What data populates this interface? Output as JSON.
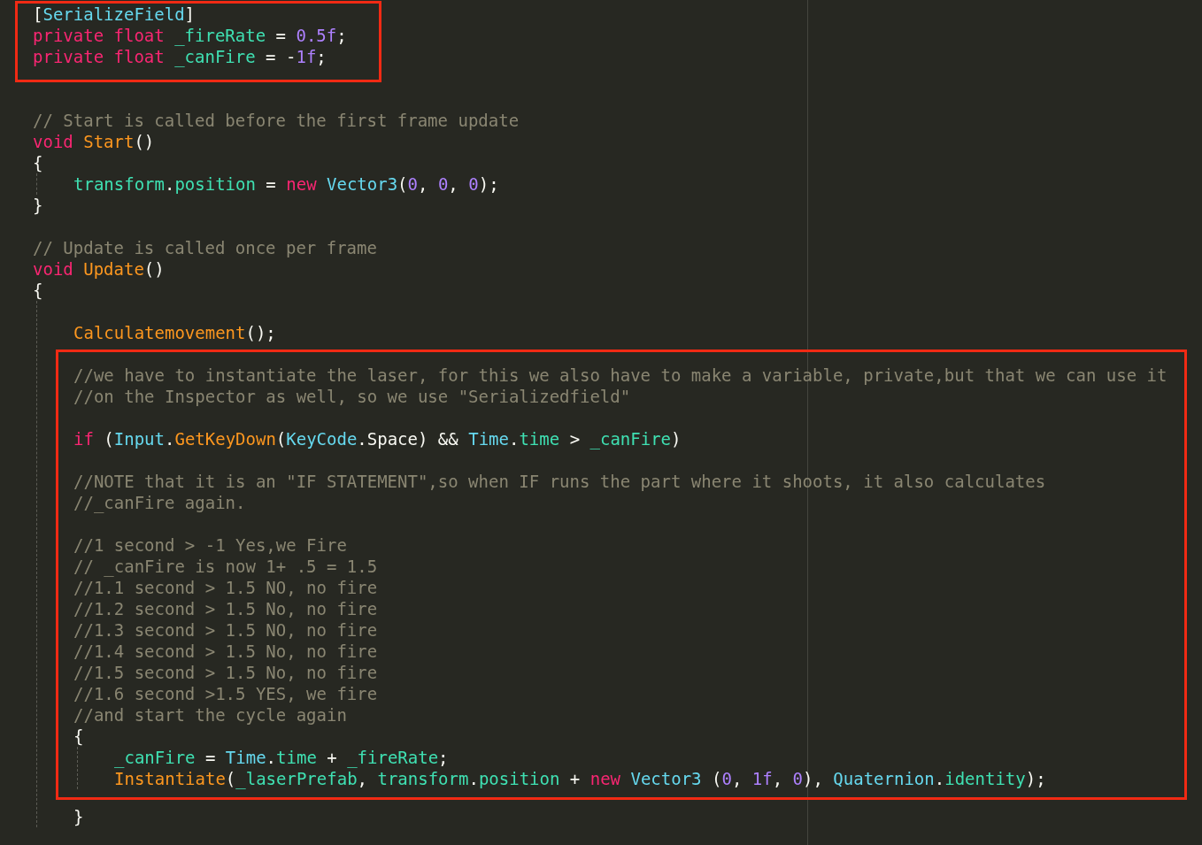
{
  "code": [
    {
      "kind": "highlight",
      "lines": [
        {
          "kind": "line",
          "tokens": [
            {
              "kind": "plain",
              "text": "["
            },
            {
              "kind": "type",
              "text": "SerializeField"
            },
            {
              "kind": "plain",
              "text": "]"
            }
          ]
        },
        {
          "kind": "line",
          "tokens": [
            {
              "kind": "kw",
              "text": "private float "
            },
            {
              "kind": "var",
              "text": "_fireRate"
            },
            {
              "kind": "plain",
              "text": " = "
            },
            {
              "kind": "num",
              "text": "0.5f"
            },
            {
              "kind": "plain",
              "text": ";"
            }
          ]
        },
        {
          "kind": "line",
          "tokens": [
            {
              "kind": "kw",
              "text": "private float "
            },
            {
              "kind": "var",
              "text": "_canFire"
            },
            {
              "kind": "plain",
              "text": " = -"
            },
            {
              "kind": "num",
              "text": "1f"
            },
            {
              "kind": "plain",
              "text": ";"
            }
          ]
        }
      ]
    },
    {
      "kind": "blank"
    },
    {
      "kind": "line",
      "tokens": [
        {
          "kind": "comment",
          "text": "// Start is called before the first frame update"
        }
      ]
    },
    {
      "kind": "line",
      "tokens": [
        {
          "kind": "kw",
          "text": "void "
        },
        {
          "kind": "fn",
          "text": "Start"
        },
        {
          "kind": "plain",
          "text": "()"
        }
      ]
    },
    {
      "kind": "line",
      "tokens": [
        {
          "kind": "plain",
          "text": "{"
        }
      ]
    },
    {
      "kind": "block",
      "lines": [
        {
          "kind": "line",
          "tokens": [
            {
              "kind": "var",
              "text": "transform"
            },
            {
              "kind": "plain",
              "text": "."
            },
            {
              "kind": "var",
              "text": "position"
            },
            {
              "kind": "plain",
              "text": " = "
            },
            {
              "kind": "kw",
              "text": "new "
            },
            {
              "kind": "type",
              "text": "Vector3"
            },
            {
              "kind": "plain",
              "text": "("
            },
            {
              "kind": "num",
              "text": "0"
            },
            {
              "kind": "plain",
              "text": ", "
            },
            {
              "kind": "num",
              "text": "0"
            },
            {
              "kind": "plain",
              "text": ", "
            },
            {
              "kind": "num",
              "text": "0"
            },
            {
              "kind": "plain",
              "text": ");"
            }
          ]
        }
      ]
    },
    {
      "kind": "line",
      "tokens": [
        {
          "kind": "plain",
          "text": "}"
        }
      ]
    },
    {
      "kind": "blank"
    },
    {
      "kind": "line",
      "tokens": [
        {
          "kind": "comment",
          "text": "// Update is called once per frame"
        }
      ]
    },
    {
      "kind": "line",
      "tokens": [
        {
          "kind": "kw",
          "text": "void "
        },
        {
          "kind": "fn",
          "text": "Update"
        },
        {
          "kind": "plain",
          "text": "()"
        }
      ]
    },
    {
      "kind": "line",
      "tokens": [
        {
          "kind": "plain",
          "text": "{"
        }
      ]
    },
    {
      "kind": "block",
      "lines": [
        {
          "kind": "blank"
        },
        {
          "kind": "line",
          "tokens": [
            {
              "kind": "fn",
              "text": "Calculatemovement"
            },
            {
              "kind": "plain",
              "text": "();"
            }
          ]
        },
        {
          "kind": "highlight",
          "lines": [
            {
              "kind": "line",
              "tokens": [
                {
                  "kind": "comment",
                  "text": "//we have to instantiate the laser, for this we also have to make a variable, private,but that we can use it"
                }
              ]
            },
            {
              "kind": "line",
              "tokens": [
                {
                  "kind": "comment",
                  "text": "//on the Inspector as well, so we use \"Serializedfield\""
                }
              ]
            },
            {
              "kind": "blank"
            },
            {
              "kind": "line",
              "tokens": [
                {
                  "kind": "kw",
                  "text": "if"
                },
                {
                  "kind": "plain",
                  "text": " ("
                },
                {
                  "kind": "type",
                  "text": "Input"
                },
                {
                  "kind": "plain",
                  "text": "."
                },
                {
                  "kind": "fn",
                  "text": "GetKeyDown"
                },
                {
                  "kind": "plain",
                  "text": "("
                },
                {
                  "kind": "type",
                  "text": "KeyCode"
                },
                {
                  "kind": "plain",
                  "text": ".Space) && "
                },
                {
                  "kind": "type",
                  "text": "Time"
                },
                {
                  "kind": "plain",
                  "text": "."
                },
                {
                  "kind": "var",
                  "text": "time"
                },
                {
                  "kind": "plain",
                  "text": " > "
                },
                {
                  "kind": "var",
                  "text": "_canFire"
                },
                {
                  "kind": "plain",
                  "text": ")"
                }
              ]
            },
            {
              "kind": "blank"
            },
            {
              "kind": "line",
              "tokens": [
                {
                  "kind": "comment",
                  "text": "//NOTE that it is an \"IF STATEMENT\",so when IF runs the part where it shoots, it also calculates"
                }
              ]
            },
            {
              "kind": "line",
              "tokens": [
                {
                  "kind": "comment",
                  "text": "//_canFire again."
                }
              ]
            },
            {
              "kind": "blank"
            },
            {
              "kind": "line",
              "tokens": [
                {
                  "kind": "comment",
                  "text": "//1 second > -1 Yes,we Fire"
                }
              ]
            },
            {
              "kind": "line",
              "tokens": [
                {
                  "kind": "comment",
                  "text": "// _canFire is now 1+ .5 = 1.5"
                }
              ]
            },
            {
              "kind": "line",
              "tokens": [
                {
                  "kind": "comment",
                  "text": "//1.1 second > 1.5 NO, no fire"
                }
              ]
            },
            {
              "kind": "line",
              "tokens": [
                {
                  "kind": "comment",
                  "text": "//1.2 second > 1.5 No, no fire"
                }
              ]
            },
            {
              "kind": "line",
              "tokens": [
                {
                  "kind": "comment",
                  "text": "//1.3 second > 1.5 NO, no fire"
                }
              ]
            },
            {
              "kind": "line",
              "tokens": [
                {
                  "kind": "comment",
                  "text": "//1.4 second > 1.5 No, no fire"
                }
              ]
            },
            {
              "kind": "line",
              "tokens": [
                {
                  "kind": "comment",
                  "text": "//1.5 second > 1.5 No, no fire"
                }
              ]
            },
            {
              "kind": "line",
              "tokens": [
                {
                  "kind": "comment",
                  "text": "//1.6 second >1.5 YES, we fire"
                }
              ]
            },
            {
              "kind": "line",
              "tokens": [
                {
                  "kind": "comment",
                  "text": "//and start the cycle again"
                }
              ]
            },
            {
              "kind": "line",
              "tokens": [
                {
                  "kind": "plain",
                  "text": "{"
                }
              ]
            },
            {
              "kind": "block",
              "lines": [
                {
                  "kind": "line",
                  "tokens": [
                    {
                      "kind": "var",
                      "text": "_canFire"
                    },
                    {
                      "kind": "plain",
                      "text": " = "
                    },
                    {
                      "kind": "type",
                      "text": "Time"
                    },
                    {
                      "kind": "plain",
                      "text": "."
                    },
                    {
                      "kind": "var",
                      "text": "time"
                    },
                    {
                      "kind": "plain",
                      "text": " + "
                    },
                    {
                      "kind": "var",
                      "text": "_fireRate"
                    },
                    {
                      "kind": "plain",
                      "text": ";"
                    }
                  ]
                },
                {
                  "kind": "line",
                  "tokens": [
                    {
                      "kind": "fn",
                      "text": "Instantiate"
                    },
                    {
                      "kind": "plain",
                      "text": "("
                    },
                    {
                      "kind": "var",
                      "text": "_laserPrefab"
                    },
                    {
                      "kind": "plain",
                      "text": ", "
                    },
                    {
                      "kind": "var",
                      "text": "transform"
                    },
                    {
                      "kind": "plain",
                      "text": "."
                    },
                    {
                      "kind": "var",
                      "text": "position"
                    },
                    {
                      "kind": "plain",
                      "text": " + "
                    },
                    {
                      "kind": "kw",
                      "text": "new "
                    },
                    {
                      "kind": "type",
                      "text": "Vector3"
                    },
                    {
                      "kind": "plain",
                      "text": " ("
                    },
                    {
                      "kind": "num",
                      "text": "0"
                    },
                    {
                      "kind": "plain",
                      "text": ", "
                    },
                    {
                      "kind": "num",
                      "text": "1f"
                    },
                    {
                      "kind": "plain",
                      "text": ", "
                    },
                    {
                      "kind": "num",
                      "text": "0"
                    },
                    {
                      "kind": "plain",
                      "text": "), "
                    },
                    {
                      "kind": "type",
                      "text": "Quaternion"
                    },
                    {
                      "kind": "plain",
                      "text": "."
                    },
                    {
                      "kind": "var",
                      "text": "identity"
                    },
                    {
                      "kind": "plain",
                      "text": ");"
                    }
                  ]
                }
              ]
            }
          ]
        },
        {
          "kind": "line",
          "tokens": [
            {
              "kind": "plain",
              "text": "}"
            }
          ]
        }
      ]
    }
  ]
}
